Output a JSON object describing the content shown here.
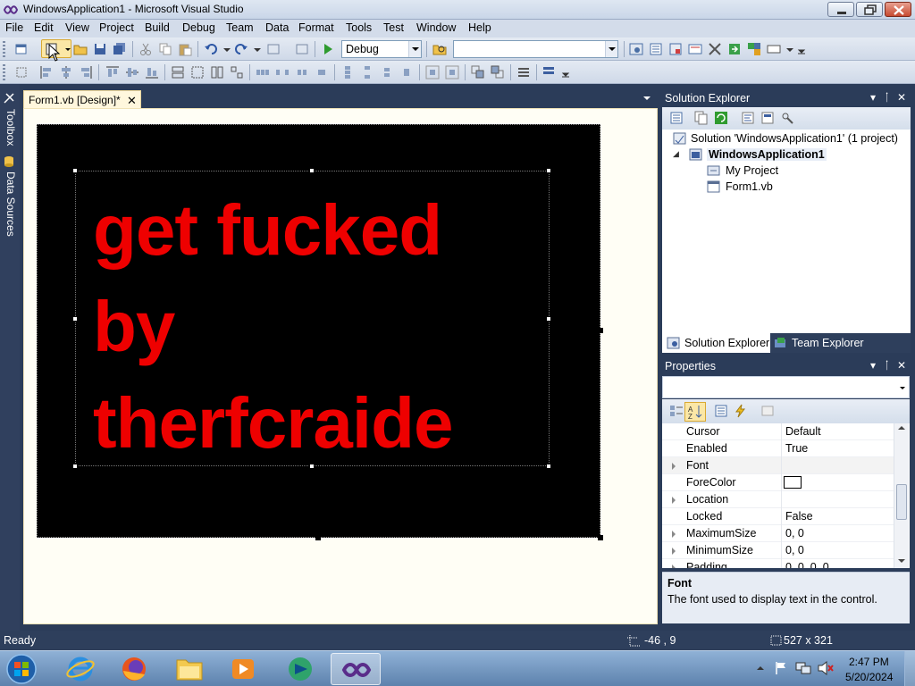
{
  "window": {
    "title": "WindowsApplication1 - Microsoft Visual Studio"
  },
  "menu": [
    "File",
    "Edit",
    "View",
    "Project",
    "Build",
    "Debug",
    "Team",
    "Data",
    "Format",
    "Tools",
    "Test",
    "Window",
    "Help"
  ],
  "toolbar": {
    "config_value": "Debug",
    "find_value": ""
  },
  "left_strip": {
    "toolbox": "Toolbox",
    "data_sources": "Data Sources"
  },
  "document": {
    "tab_label": "Form1.vb [Design]*",
    "tab_close": "✕",
    "label_lines": [
      "get fucked",
      "by",
      "therfcraide"
    ]
  },
  "solution_explorer": {
    "title": "Solution Explorer",
    "pin": "▾ ᛙ ✕",
    "tree": [
      {
        "text": "Solution 'WindowsApplication1' (1 project)",
        "bold": false
      },
      {
        "text": "WindowsApplication1",
        "bold": true
      },
      {
        "text": "My Project",
        "bold": false
      },
      {
        "text": "Form1.vb",
        "bold": false
      }
    ],
    "tabs": [
      "Solution Explorer",
      "Team Explorer"
    ]
  },
  "properties": {
    "title": "Properties",
    "object_selector": "",
    "rows": [
      {
        "name": "Cursor",
        "value": "Default",
        "expandable": false
      },
      {
        "name": "Enabled",
        "value": "True",
        "expandable": false
      },
      {
        "name": "Font",
        "value": "",
        "expandable": true
      },
      {
        "name": "ForeColor",
        "value": "",
        "expandable": false,
        "swatch": "#ffffff"
      },
      {
        "name": "Location",
        "value": "",
        "expandable": true
      },
      {
        "name": "Locked",
        "value": "False",
        "expandable": false
      },
      {
        "name": "MaximumSize",
        "value": "0, 0",
        "expandable": true
      },
      {
        "name": "MinimumSize",
        "value": "0, 0",
        "expandable": true
      },
      {
        "name": "Padding",
        "value": "0, 0, 0, 0",
        "expandable": true
      }
    ],
    "description_title": "Font",
    "description_text": "The font used to display text in the control."
  },
  "status": {
    "text": "Ready",
    "position": "-46 , 9",
    "size": "527 x 321"
  },
  "taskbar": {
    "time": "2:47 PM",
    "date": "5/20/2024"
  },
  "colors": {
    "label_text": "#ee0000",
    "form_background": "#000000",
    "ide_chrome": "#2b3c59"
  }
}
